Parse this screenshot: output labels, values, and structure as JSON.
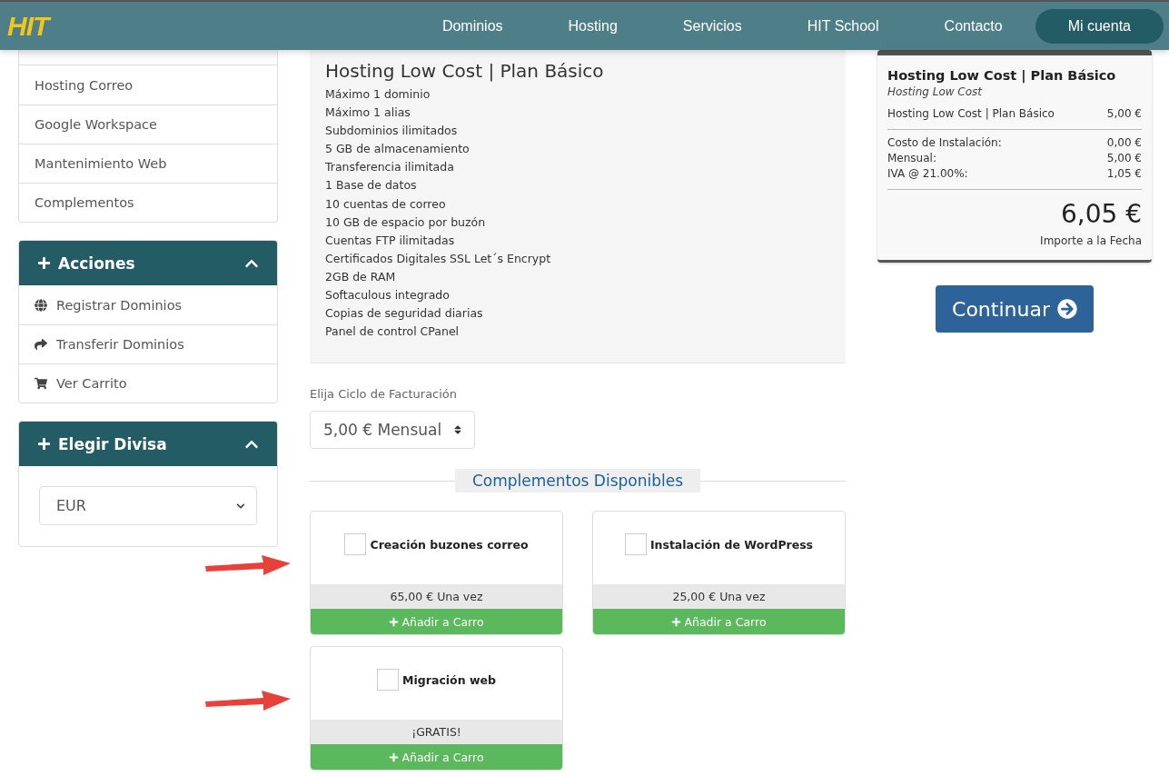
{
  "header": {
    "logo": "HIT",
    "nav": [
      {
        "label": "Dominios",
        "selected": false
      },
      {
        "label": "Hosting",
        "selected": false
      },
      {
        "label": "Servicios",
        "selected": false
      },
      {
        "label": "HIT School",
        "selected": false
      },
      {
        "label": "Contacto",
        "selected": false
      },
      {
        "label": "Mi cuenta",
        "selected": true
      }
    ]
  },
  "sidebar": {
    "categories": [
      "Hosting Correo",
      "Google Workspace",
      "Mantenimiento Web",
      "Complementos"
    ],
    "actions": {
      "title": "Acciones",
      "expanded": true,
      "items": [
        {
          "label": "Registrar Dominios"
        },
        {
          "label": "Transferir Dominios"
        },
        {
          "label": "Ver Carrito"
        }
      ]
    },
    "currency": {
      "title": "Elegir Divisa",
      "expanded": true,
      "value": "EUR"
    }
  },
  "product": {
    "title": "Hosting Low Cost | Plan Básico",
    "features": [
      "Máximo 1 dominio",
      "Máximo 1 alias",
      "Subdominios ilimitados",
      "5 GB de almacenamiento",
      "Transferencia ilimitada",
      "1 Base de datos",
      "10 cuentas de correo",
      "10 GB de espacio por buzón",
      "Cuentas FTP ilimitadas",
      "Certificados Digitales SSL Let´s Encrypt",
      "2GB de RAM",
      "Softaculous integrado",
      "Copias de seguridad diarias",
      "Panel de control CPanel"
    ]
  },
  "billing": {
    "label": "Elija Ciclo de Facturación",
    "value": "5,00 € Mensual"
  },
  "addons": {
    "title": "Complementos Disponibles",
    "items": [
      {
        "name": "Creación buzones correo",
        "checked": false,
        "price": "65,00 € Una vez",
        "button": "Añadir a Carro",
        "arrow": true
      },
      {
        "name": "Instalación de WordPress",
        "checked": false,
        "price": "25,00 € Una vez",
        "button": "Añadir a Carro",
        "arrow": false
      },
      {
        "name": "Migración web",
        "checked": false,
        "price": "¡GRATIS!",
        "button": "Añadir a Carro",
        "arrow": true
      }
    ]
  },
  "summary": {
    "title": "Hosting Low Cost | Plan Básico",
    "subtitle": "Hosting Low Cost",
    "line": {
      "label": "Hosting Low Cost | Plan Básico",
      "amount": "5,00 €"
    },
    "rows": [
      {
        "label": "Costo de Instalación:",
        "amount": "0,00 €"
      },
      {
        "label": "Mensual:",
        "amount": "5,00 €"
      },
      {
        "label": "IVA @ 21.00%:",
        "amount": "1,05 €"
      }
    ],
    "total": "6,05 €",
    "total_label": "Importe a la Fecha",
    "button": "Continuar"
  }
}
